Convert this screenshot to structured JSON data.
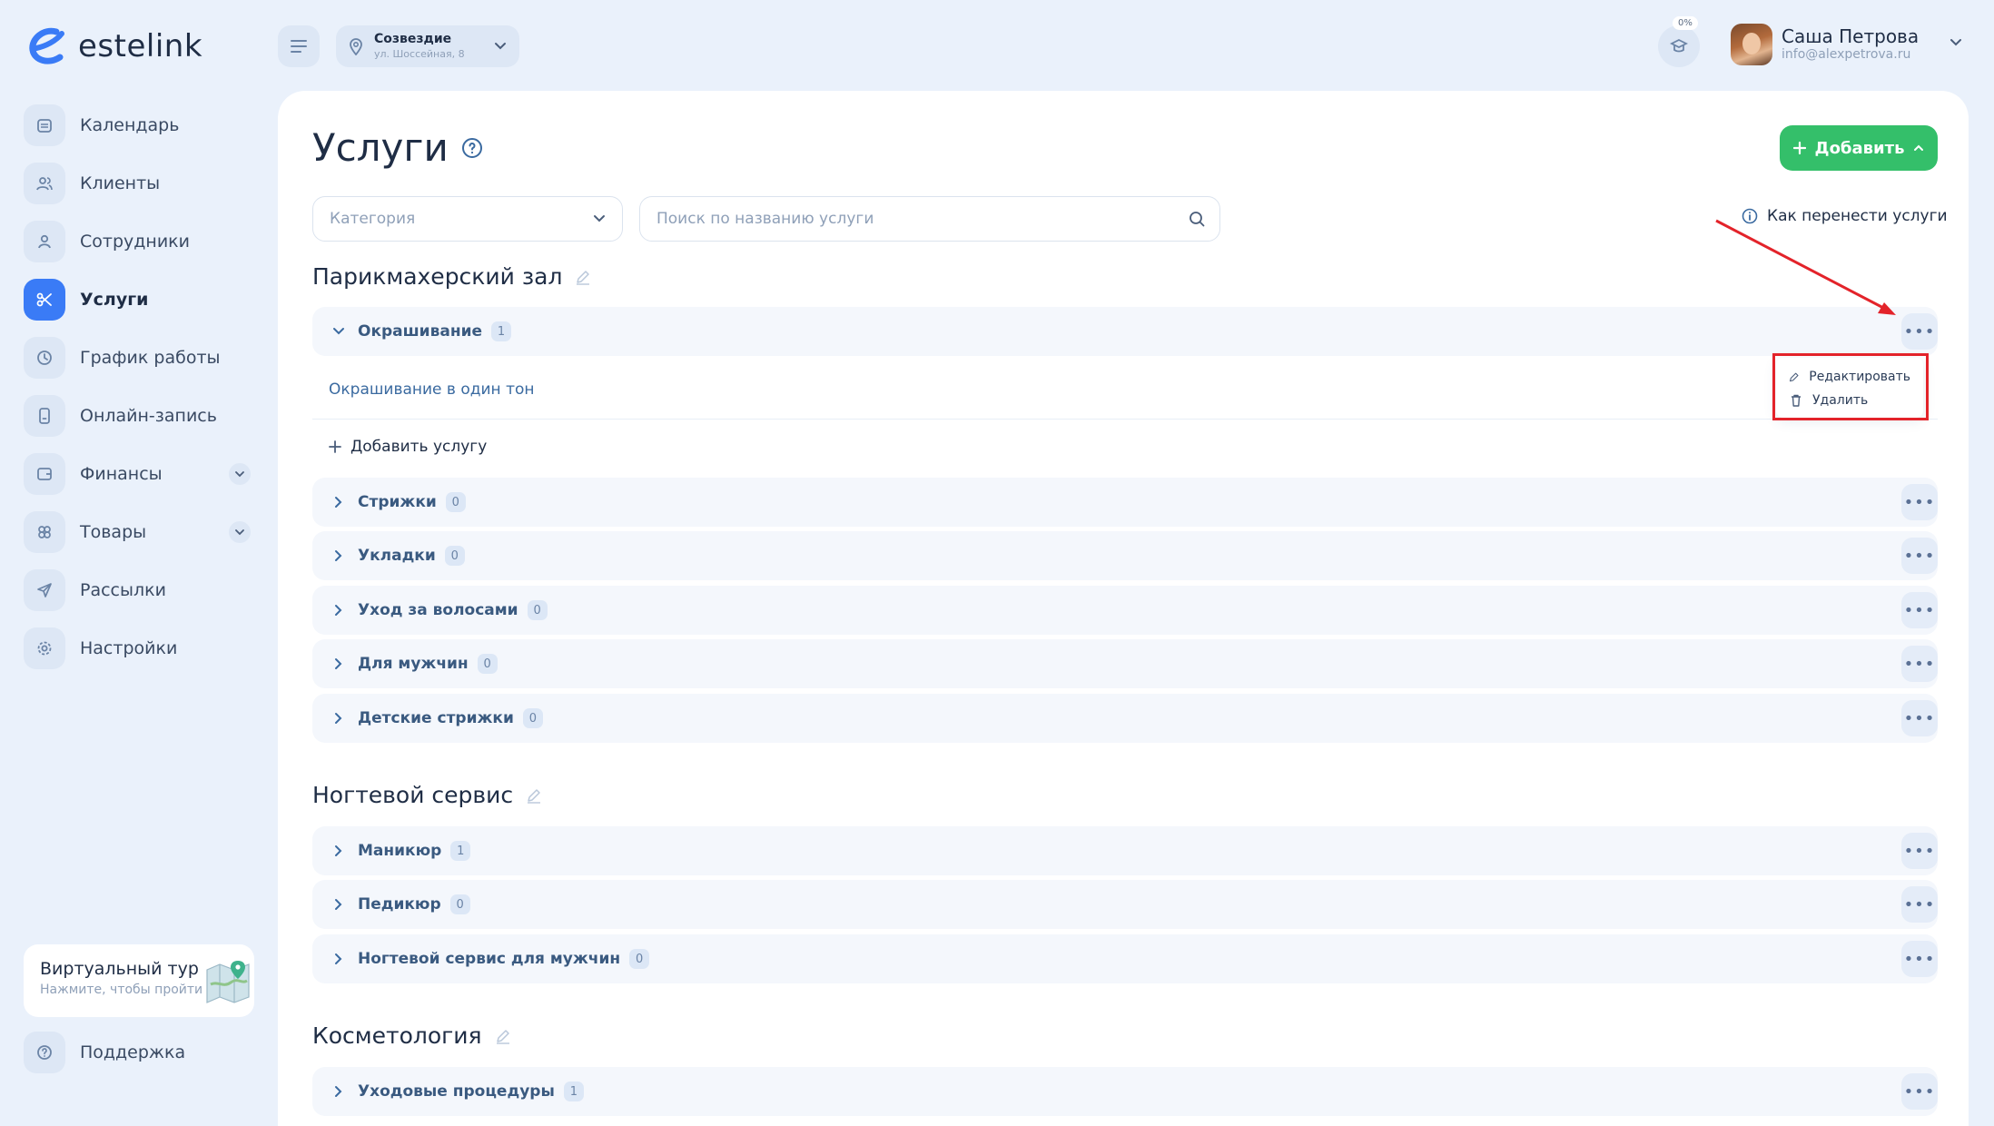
{
  "brand": {
    "name": "estelink"
  },
  "location": {
    "name": "Созвездие",
    "address": "ул. Шоссейная, 8"
  },
  "progress": {
    "label": "0%",
    "value": 0
  },
  "user": {
    "name": "Саша Петрова",
    "email": "info@alexpetrova.ru"
  },
  "sidebar": {
    "items": [
      {
        "label": "Календарь",
        "icon": "calendar-icon"
      },
      {
        "label": "Клиенты",
        "icon": "clients-icon"
      },
      {
        "label": "Сотрудники",
        "icon": "employee-icon"
      },
      {
        "label": "Услуги",
        "icon": "scissors-icon",
        "active": true
      },
      {
        "label": "График работы",
        "icon": "clock-icon"
      },
      {
        "label": "Онлайн-запись",
        "icon": "phone-icon"
      },
      {
        "label": "Финансы",
        "icon": "wallet-icon",
        "expandable": true
      },
      {
        "label": "Товары",
        "icon": "products-icon",
        "expandable": true
      },
      {
        "label": "Рассылки",
        "icon": "send-icon"
      },
      {
        "label": "Настройки",
        "icon": "gear-icon"
      }
    ],
    "tour": {
      "title": "Виртуальный тур",
      "subtitle": "Нажмите, чтобы пройти"
    },
    "support": {
      "label": "Поддержка",
      "icon": "help-icon"
    }
  },
  "page": {
    "title": "Услуги",
    "add_button": "Добавить",
    "category_placeholder": "Категория",
    "search_placeholder": "Поиск по названию услуги",
    "howto_link": "Как перенести услуги"
  },
  "sections": [
    {
      "title": "Парикмахерский зал",
      "categories": [
        {
          "name": "Окрашивание",
          "count": "1",
          "expanded": true
        },
        {
          "name": "Стрижки",
          "count": "0"
        },
        {
          "name": "Укладки",
          "count": "0"
        },
        {
          "name": "Уход за волосами",
          "count": "0"
        },
        {
          "name": "Для мужчин",
          "count": "0"
        },
        {
          "name": "Детские стрижки",
          "count": "0"
        }
      ],
      "services": [
        "Окрашивание в один тон"
      ],
      "add_service": "Добавить услугу"
    },
    {
      "title": "Ногтевой сервис",
      "categories": [
        {
          "name": "Маникюр",
          "count": "1"
        },
        {
          "name": "Педикюр",
          "count": "0"
        },
        {
          "name": "Ногтевой сервис для мужчин",
          "count": "0"
        }
      ]
    },
    {
      "title": "Косметология",
      "categories": [
        {
          "name": "Уходовые процедуры",
          "count": "1"
        }
      ]
    }
  ],
  "context_menu": {
    "edit": "Редактировать",
    "delete": "Удалить"
  },
  "colors": {
    "accent": "#3a7bf6",
    "add_button": "#34bf6a",
    "annotation": "#e3232a"
  }
}
